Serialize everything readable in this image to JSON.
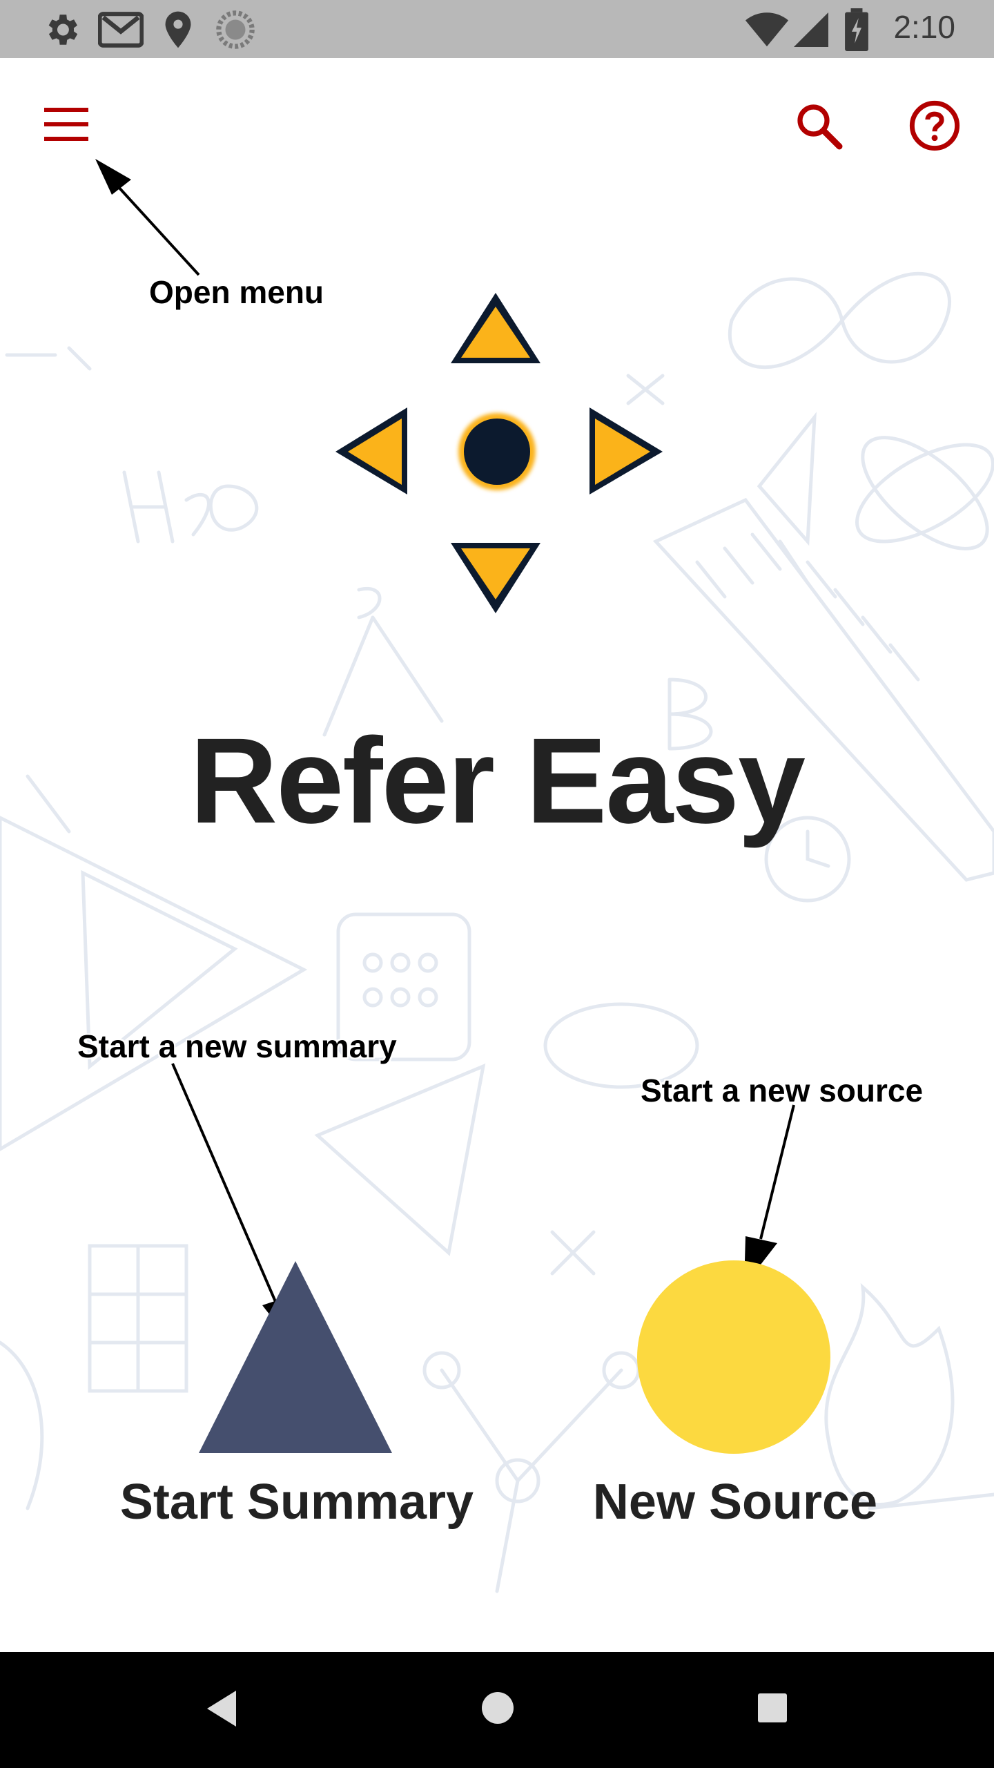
{
  "status_bar": {
    "time": "2:10",
    "left_icons": [
      "settings-icon",
      "gmail-icon",
      "location-icon",
      "sync-icon"
    ],
    "right_icons": [
      "wifi-icon",
      "signal-icon",
      "battery-icon"
    ]
  },
  "app_bar": {
    "menu_icon": "menu-icon",
    "search_icon": "search-icon",
    "help_icon": "help-icon",
    "accent_color": "#b20000"
  },
  "annotations": {
    "open_menu": "Open menu",
    "start_summary": "Start a new summary",
    "start_source": "Start a new source"
  },
  "title": "Refer Easy",
  "actions": {
    "start_summary": {
      "label": "Start Summary",
      "color": "#454f6e"
    },
    "new_source": {
      "label": "New Source",
      "color": "#fcd940"
    }
  },
  "logo": {
    "arrow_color": "#fbb31a",
    "center_color": "#0c1a2e"
  },
  "nav_bar": {
    "back": "back-icon",
    "home": "home-icon",
    "recents": "recents-icon"
  }
}
